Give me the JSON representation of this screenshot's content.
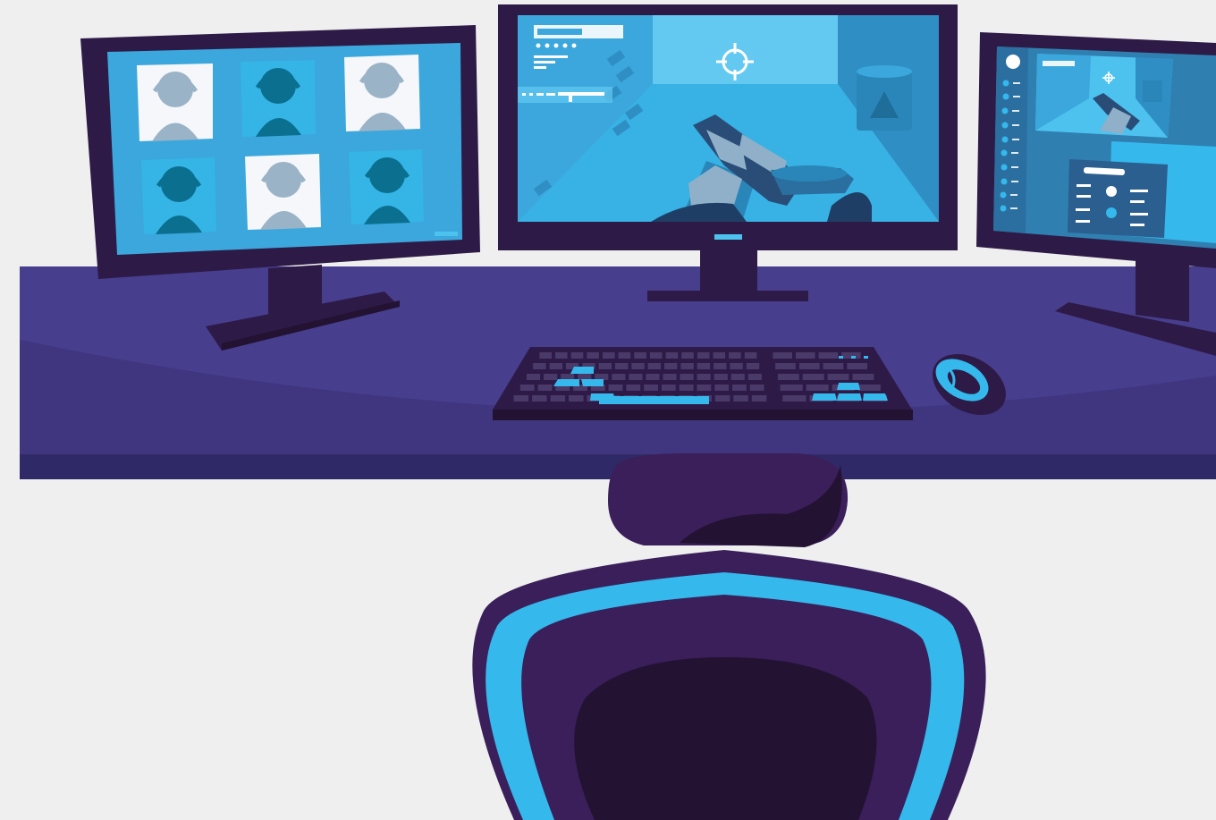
{
  "scene": {
    "colors": {
      "background": "#efefef",
      "frame_dark": "#2e1a47",
      "frame_mid": "#3a1f5a",
      "desk_top": "#473e8e",
      "desk_front": "#3f367f",
      "desk_edge": "#2f2a67",
      "screen_blue": "#3ba7dc",
      "screen_light": "#4dc2ef",
      "screen_mid": "#2f8fc4",
      "tile_light": "#f5f7fa",
      "tile_cyan": "#35b4e6",
      "avatar_gray": "#9ab3c6",
      "avatar_teal": "#0b6f8f",
      "chair_blue": "#35b8ec",
      "chair_dark": "#231232"
    },
    "icons": [
      "monitor-left-video-call",
      "monitor-center-shooter-game",
      "monitor-right-game-settings",
      "crosshair-icon",
      "rifle-icon",
      "keyboard-icon",
      "mouse-icon",
      "gaming-chair-icon"
    ]
  }
}
